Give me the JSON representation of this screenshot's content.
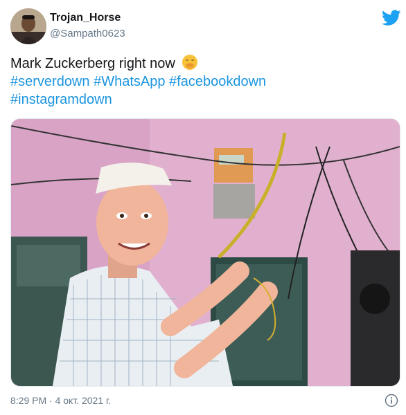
{
  "user": {
    "display_name": "Trojan_Horse",
    "handle": "@Sampath0623"
  },
  "tweet": {
    "text": "Mark Zuckerberg right now",
    "emoji": "hand-over-mouth-emoji",
    "hashtags": [
      "#serverdown",
      "#WhatsApp",
      "#facebookdown",
      "#instagramdown"
    ]
  },
  "media": {
    "kind": "photo"
  },
  "footer": {
    "time": "8:29 PM",
    "separator": " · ",
    "date": "4 окт. 2021 г."
  },
  "icons": {
    "brand": "twitter-bird-icon",
    "info": "info-icon"
  },
  "colors": {
    "link": "#1b95e0",
    "brand": "#1da1f2",
    "muted": "#657786"
  }
}
